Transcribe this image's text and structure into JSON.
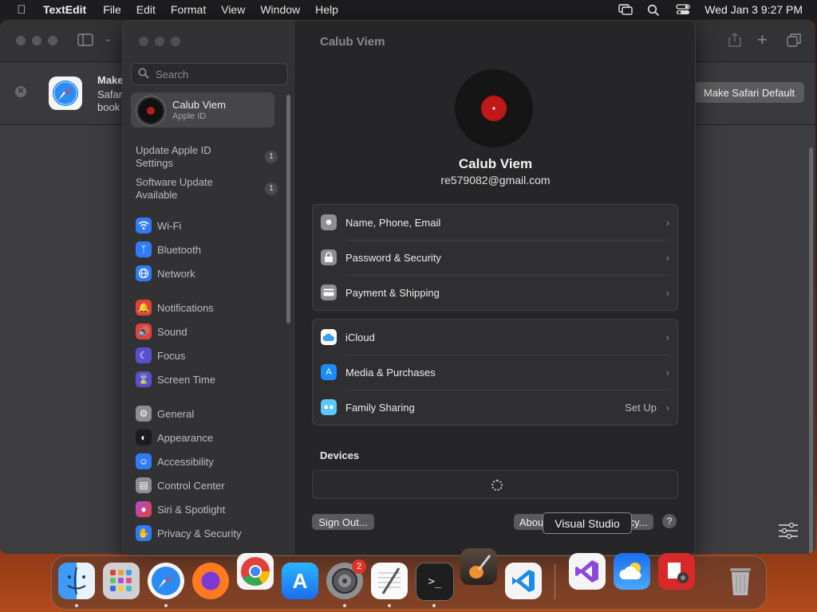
{
  "menubar": {
    "app_name": "TextEdit",
    "items": [
      "File",
      "Edit",
      "Format",
      "View",
      "Window",
      "Help"
    ],
    "datetime": "Wed Jan 3  9:27 PM"
  },
  "safari": {
    "banner_title": "Make",
    "banner_line2": "Safar",
    "banner_line3": "book",
    "make_default_label": "Make Safari Default"
  },
  "settings": {
    "window_title": "Calub Viem",
    "search_placeholder": "Search",
    "account": {
      "name": "Calub Viem",
      "subtitle": "Apple ID"
    },
    "updates": [
      {
        "label_line1": "Update Apple ID",
        "label_line2": "Settings",
        "badge": "1"
      },
      {
        "label_line1": "Software Update",
        "label_line2": "Available",
        "badge": "1"
      }
    ],
    "nav_items": [
      {
        "label": "Wi-Fi",
        "icon": "wifi-icon",
        "color": "#2f7cf6"
      },
      {
        "label": "Bluetooth",
        "icon": "bluetooth-icon",
        "color": "#2f7cf6"
      },
      {
        "label": "Network",
        "icon": "globe-icon",
        "color": "#2f7cf6"
      },
      {
        "label": "Notifications",
        "icon": "bell-icon",
        "color": "#e0423a"
      },
      {
        "label": "Sound",
        "icon": "speaker-icon",
        "color": "#e0423a"
      },
      {
        "label": "Focus",
        "icon": "moon-icon",
        "color": "#5a4fcf"
      },
      {
        "label": "Screen Time",
        "icon": "hourglass-icon",
        "color": "#5a4fcf"
      },
      {
        "label": "General",
        "icon": "gear-icon",
        "color": "#8e8e93"
      },
      {
        "label": "Appearance",
        "icon": "appearance-icon",
        "color": "#1c1c1e"
      },
      {
        "label": "Accessibility",
        "icon": "accessibility-icon",
        "color": "#2f7cf6"
      },
      {
        "label": "Control Center",
        "icon": "control-center-icon",
        "color": "#8e8e93"
      },
      {
        "label": "Siri & Spotlight",
        "icon": "siri-icon",
        "color": "#b04ad8"
      },
      {
        "label": "Privacy & Security",
        "icon": "hand-icon",
        "color": "#2f7cf6"
      }
    ],
    "user": {
      "name": "Calub Viem",
      "email": "re579082@gmail.com"
    },
    "group1": [
      {
        "label": "Name, Phone, Email",
        "icon": "contact-card-icon",
        "color": "#8e8e93"
      },
      {
        "label": "Password & Security",
        "icon": "lock-icon",
        "color": "#8e8e93"
      },
      {
        "label": "Payment & Shipping",
        "icon": "credit-card-icon",
        "color": "#8e8e93"
      }
    ],
    "group2": [
      {
        "label": "iCloud",
        "icon": "icloud-icon",
        "color": "#ffffff",
        "extra": ""
      },
      {
        "label": "Media & Purchases",
        "icon": "app-store-icon",
        "color": "#1a8cff",
        "extra": ""
      },
      {
        "label": "Family Sharing",
        "icon": "family-icon",
        "color": "#5ac8fa",
        "extra": "Set Up"
      }
    ],
    "devices_title": "Devices",
    "sign_out_label": "Sign Out...",
    "about_label": "Abou",
    "privacy_label": "cy...",
    "help_label": "?"
  },
  "tooltip": "Visual Studio",
  "dock": {
    "apps": [
      "finder-icon",
      "launchpad-icon",
      "safari-icon",
      "firefox-icon",
      "chrome-icon",
      "app-store-icon",
      "system-settings-icon",
      "textedit-icon",
      "terminal-icon",
      "garageband-icon",
      "vscode-icon",
      "visual-studio-icon",
      "weather-icon",
      "photo-booth-icon",
      "trash-icon"
    ],
    "settings_badge": "2"
  }
}
